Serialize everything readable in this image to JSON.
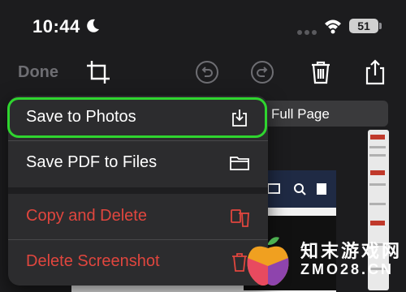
{
  "status_bar": {
    "time": "10:44",
    "battery": "51"
  },
  "toolbar": {
    "done_label": "Done"
  },
  "background": {
    "full_page_label": "Full Page"
  },
  "menu": {
    "items": [
      {
        "label": "Save to Photos",
        "icon": "save-to-photos-icon",
        "highlighted": true
      },
      {
        "label": "Save PDF to Files",
        "icon": "folder-icon"
      },
      {
        "label": "Copy and Delete",
        "icon": "copy-delete-icon",
        "destructive": true
      },
      {
        "label": "Delete Screenshot",
        "icon": "trash-icon",
        "destructive": true
      }
    ]
  },
  "watermark": {
    "line1": "知末游戏网",
    "line2": "ZMO28.CN"
  },
  "colors": {
    "highlight": "#2fd52f",
    "destructive": "#e0463e",
    "menu_bg": "#2c2c2e"
  }
}
